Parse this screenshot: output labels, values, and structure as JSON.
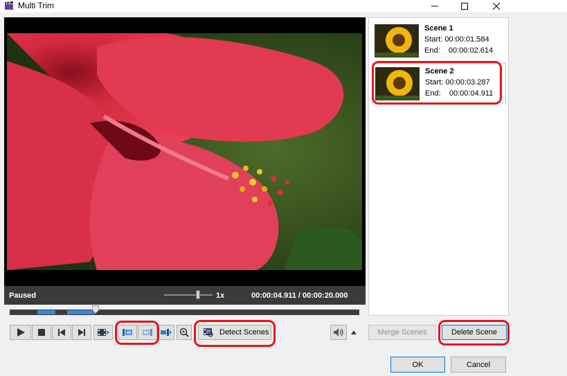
{
  "window": {
    "title": "Multi Trim",
    "icons": {
      "app": "film-clapper-icon",
      "minimize": "minimize-icon",
      "maximize": "maximize-icon",
      "close": "close-icon"
    }
  },
  "player": {
    "status": "Paused",
    "speed": "1x",
    "speed_level": 0.7,
    "current_time": "00:00:04.911",
    "separator": "/",
    "total_time": "00:00:20.000",
    "playhead_fraction": 0.246,
    "segments": [
      {
        "start_fraction": 0.079,
        "end_fraction": 0.131
      },
      {
        "start_fraction": 0.164,
        "end_fraction": 0.246
      }
    ]
  },
  "toolbar": {
    "play": "play-icon",
    "stop": "stop-icon",
    "prev_frame": "skip-back-icon",
    "next_frame": "skip-forward-icon",
    "trim": "film-trim-icon",
    "mark_in": "mark-in-icon",
    "mark_out": "mark-out-icon",
    "add_marker": "add-marker-icon",
    "zoom": "zoom-in-icon",
    "detect_scenes_label": "Detect Scenes",
    "detect_scenes_icon": "scene-detect-icon",
    "volume": "speaker-icon",
    "volume_menu": "triangle-up-icon"
  },
  "scenes": [
    {
      "name": "Scene 1",
      "start_label": "Start:",
      "start": "00:00:01.584",
      "end_label": "End:",
      "end": "00:00:02.614"
    },
    {
      "name": "Scene 2",
      "start_label": "Start:",
      "start": "00:00:03.287",
      "end_label": "End:",
      "end": "00:00:04.911"
    }
  ],
  "buttons": {
    "merge": "Merge Scenes",
    "delete": "Delete Scene",
    "ok": "OK",
    "cancel": "Cancel"
  },
  "colors": {
    "highlight": "#e8141c",
    "segment": "#3b86d8",
    "accent": "#0078d7"
  }
}
